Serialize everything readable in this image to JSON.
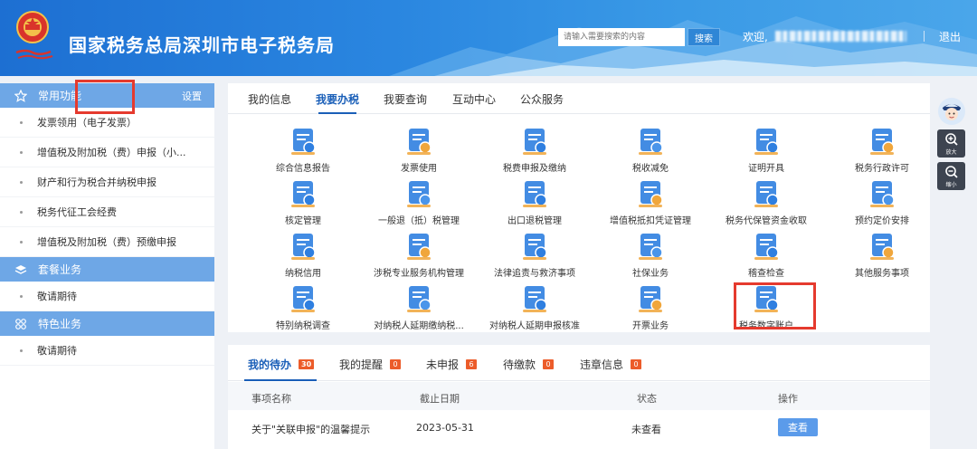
{
  "header": {
    "title": "国家税务总局深圳市电子税务局",
    "search_placeholder": "请输入需要搜索的内容",
    "search_label": "搜索",
    "welcome": "欢迎,",
    "logout": "退出",
    "colors": {
      "bg_start": "#1d6fd2",
      "bg_end": "#4aa6ea"
    }
  },
  "sidebar": {
    "sections": [
      {
        "title": "常用功能",
        "icon": "star-icon",
        "settings": "设置",
        "items": [
          "发票领用（电子发票）",
          "增值税及附加税（费）申报（小...",
          "财产和行为税合并纳税申报",
          "税务代征工会经费",
          "增值税及附加税（费）预缴申报"
        ]
      },
      {
        "title": "套餐业务",
        "icon": "layers-icon",
        "items": [
          "敬请期待"
        ]
      },
      {
        "title": "特色业务",
        "icon": "grid-icon",
        "items": [
          "敬请期待"
        ]
      }
    ]
  },
  "main": {
    "tabs": [
      "我的信息",
      "我要办税",
      "我要查询",
      "互动中心",
      "公众服务"
    ],
    "active_tab": "我要办税",
    "grid": [
      [
        "综合信息报告",
        "发票使用",
        "税费申报及缴纳",
        "税收减免",
        "证明开具",
        "税务行政许可"
      ],
      [
        "核定管理",
        "一般退（抵）税管理",
        "出口退税管理",
        "增值税抵扣凭证管理",
        "税务代保管资金收取",
        "预约定价安排"
      ],
      [
        "纳税信用",
        "涉税专业服务机构管理",
        "法律追责与救济事项",
        "社保业务",
        "稽查检查",
        "其他服务事项"
      ],
      [
        "特别纳税调查",
        "对纳税人延期缴纳税...",
        "对纳税人延期申报核准",
        "开票业务",
        "税务数字账户"
      ]
    ],
    "highlighted_item": "税务数字账户",
    "accent": "#1a5fb8",
    "highlight_color": "#e53a2e"
  },
  "bottom": {
    "tabs": [
      {
        "label": "我的待办",
        "count": "30"
      },
      {
        "label": "我的提醒",
        "count": "0"
      },
      {
        "label": "未申报",
        "count": "6"
      },
      {
        "label": "待缴款",
        "count": "0"
      },
      {
        "label": "违章信息",
        "count": "0"
      }
    ],
    "columns": [
      "事项名称",
      "截止日期",
      "状态",
      "操作"
    ],
    "rows": [
      {
        "name": "关于\"关联申报\"的温馨提示",
        "deadline": "2023-05-31",
        "status": "未查看",
        "action": "查看"
      }
    ]
  },
  "float": {
    "zoom_in": "放大",
    "zoom_out": "缩小"
  }
}
